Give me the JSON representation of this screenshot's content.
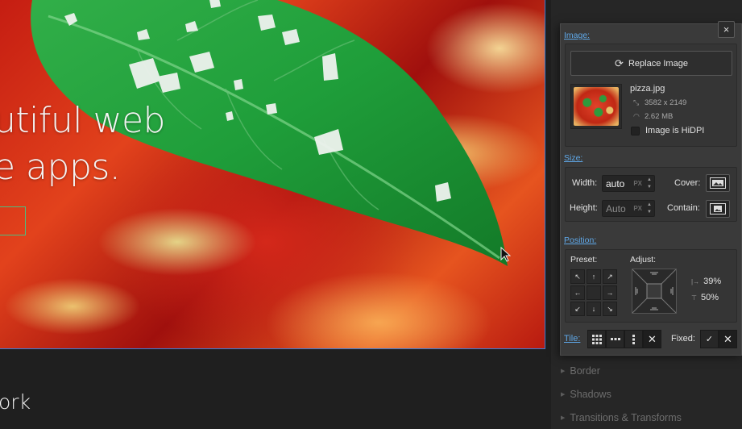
{
  "hero": {
    "line1": "utiful web",
    "line2": "e apps."
  },
  "bottom_text": "ork",
  "sidebar": {
    "items": [
      "Border",
      "Shadows",
      "Transitions & Transforms"
    ]
  },
  "panel": {
    "close_label": "×",
    "image_section": {
      "label": "Image:",
      "replace_button": "Replace Image",
      "filename": "pizza.jpg",
      "dimensions": "3582 x 2149",
      "filesize": "2.62 MB",
      "hidpi_label": "Image is HiDPI",
      "hidpi_checked": false
    },
    "size_section": {
      "label": "Size:",
      "width_label": "Width:",
      "width_value": "auto",
      "width_unit": "PX",
      "height_label": "Height:",
      "height_value": "Auto",
      "height_unit": "PX",
      "cover_label": "Cover:",
      "contain_label": "Contain:"
    },
    "position_section": {
      "label": "Position:",
      "preset_label": "Preset:",
      "adjust_label": "Adjust:",
      "x_value": "39%",
      "y_value": "50%"
    },
    "tile": {
      "label": "Tile:",
      "fixed_label": "Fixed:"
    }
  },
  "colors": {
    "accent": "#5fa8e8",
    "panel_bg": "#3a3a3a",
    "app_bg": "#1f1f1f"
  }
}
